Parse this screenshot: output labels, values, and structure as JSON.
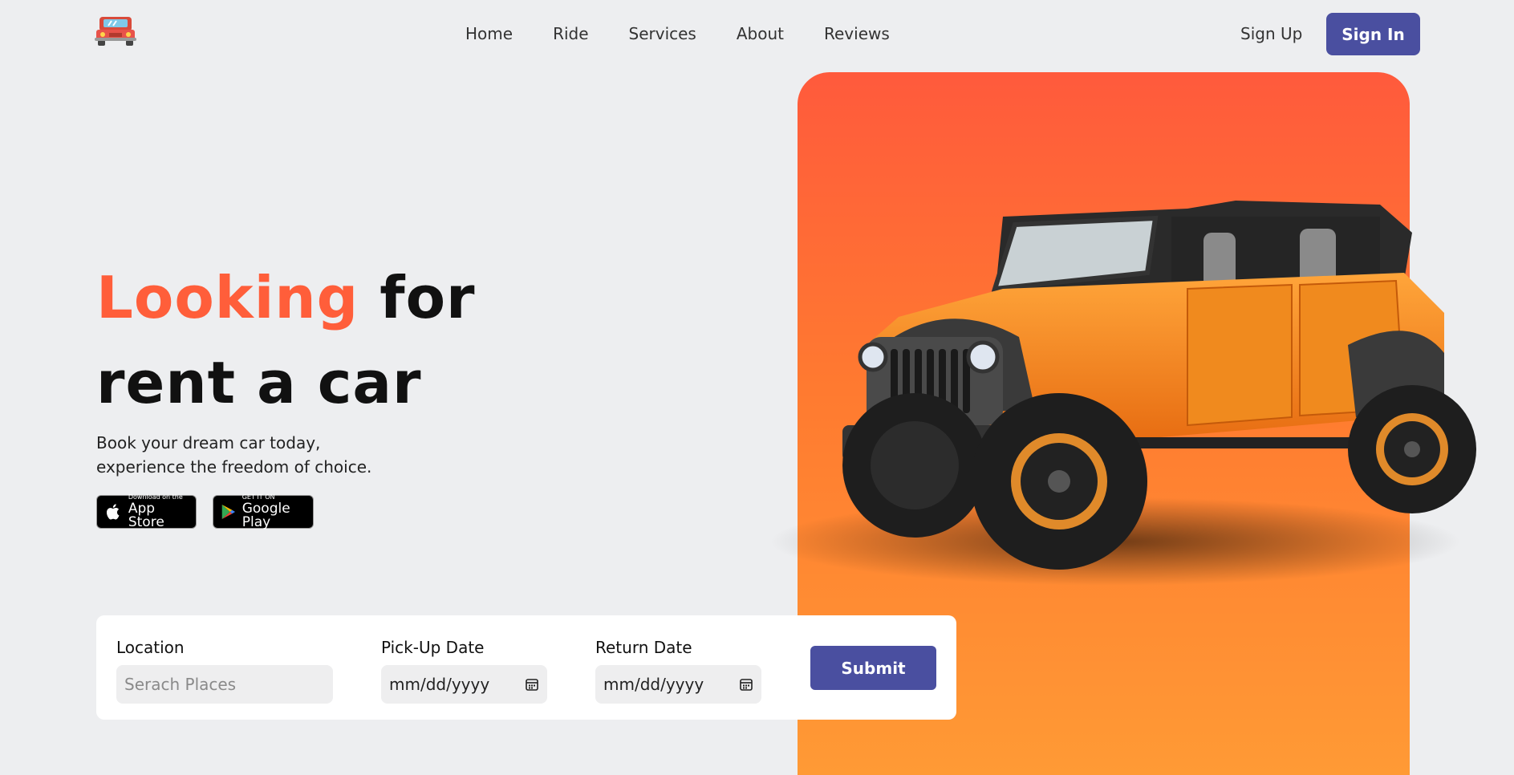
{
  "nav": {
    "items": [
      {
        "label": "Home"
      },
      {
        "label": "Ride"
      },
      {
        "label": "Services"
      },
      {
        "label": "About"
      },
      {
        "label": "Reviews"
      }
    ],
    "signup_label": "Sign Up",
    "signin_label": "Sign In"
  },
  "hero": {
    "title_accent": "Looking",
    "title_rest_line1": " for",
    "title_line2": "rent a car",
    "subtitle_line1": "Book your dream car today,",
    "subtitle_line2": "experience the freedom of choice.",
    "badges": {
      "apple_small": "Download on the",
      "apple_big": "App Store",
      "google_small": "GET IT ON",
      "google_big": "Google Play"
    }
  },
  "form": {
    "location_label": "Location",
    "location_placeholder": "Serach Places",
    "pickup_label": "Pick-Up Date",
    "pickup_value": "mm/dd/yyyy",
    "return_label": "Return Date",
    "return_value": "mm/dd/yyyy",
    "submit_label": "Submit"
  },
  "colors": {
    "accent": "#ff5e3a",
    "primary_button": "#4a4fa0",
    "background": "#edeef0",
    "card_gradient_top": "#ff5a3c",
    "card_gradient_bottom": "#ff9a35"
  },
  "icons": {
    "logo": "red-jeep-logo-icon",
    "calendar": "calendar-icon",
    "apple": "apple-icon",
    "google_play": "google-play-icon"
  }
}
